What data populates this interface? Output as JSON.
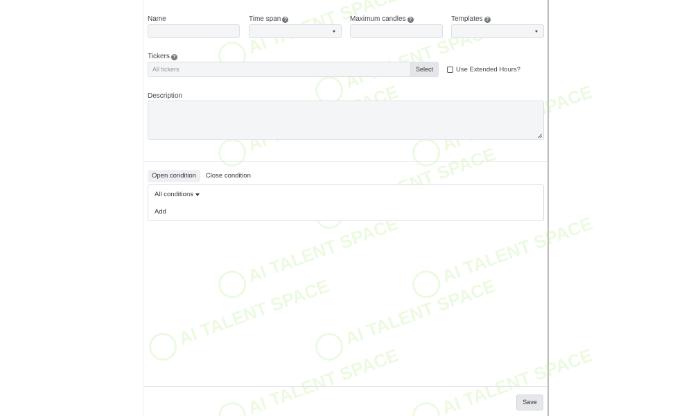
{
  "form": {
    "name_label": "Name",
    "name_value": "",
    "timespan_label": "Time span",
    "max_candles_label": "Maximum candles",
    "max_candles_value": "",
    "templates_label": "Templates",
    "tickers_label": "Tickers",
    "tickers_placeholder": "All tickers",
    "select_button_label": "Select",
    "extended_hours_label": "Use Extended Hours?",
    "description_label": "Description",
    "help_glyph": "?"
  },
  "conditions": {
    "tabs": [
      {
        "label": "Open condition",
        "active": true
      },
      {
        "label": "Close condition",
        "active": false
      }
    ],
    "filter_label": "All conditions",
    "add_label": "Add"
  },
  "footer": {
    "save_label": "Save"
  },
  "watermark": {
    "text": "AI TALENT SPACE"
  }
}
